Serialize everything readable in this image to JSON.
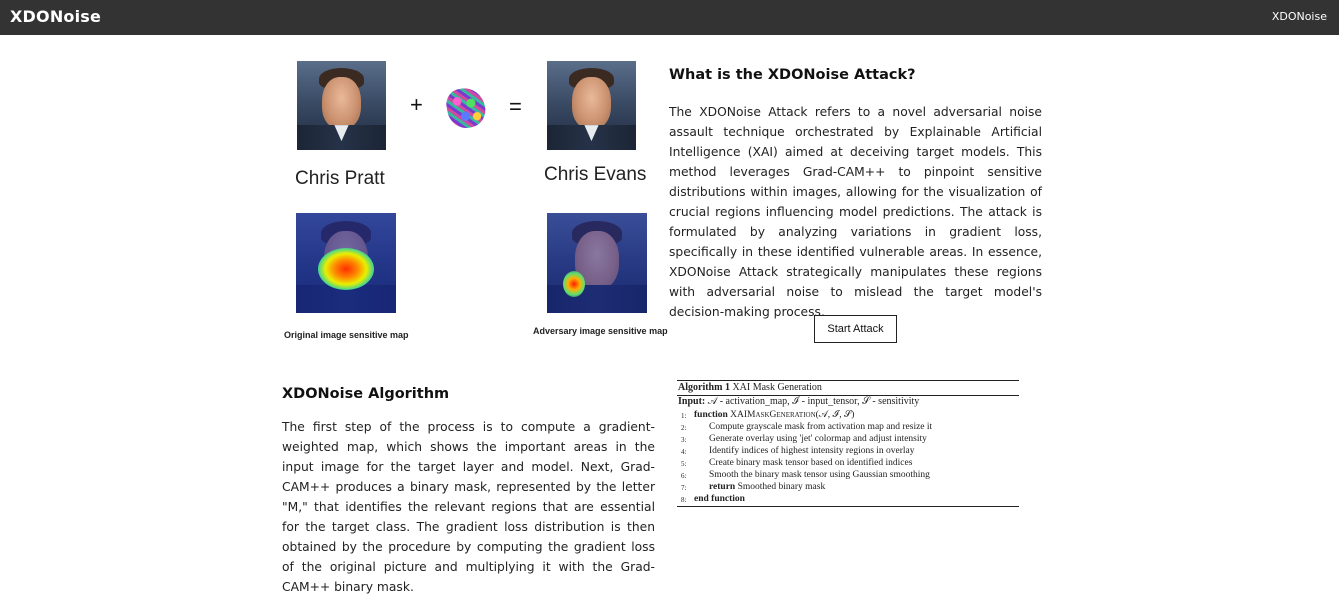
{
  "navbar": {
    "brand": "XDONoise",
    "link": "XDONoise"
  },
  "illustration": {
    "plus": "+",
    "equals": "=",
    "original_name": "Chris Pratt",
    "adversary_name": "Chris Evans",
    "original_caption": "Original image sensitive map",
    "adversary_caption": "Adversary image sensitive map"
  },
  "attack": {
    "title": "What is the XDONoise Attack?",
    "description": "The XDONoise Attack refers to a novel adversarial noise assault technique orchestrated by Explainable Artificial Intelligence (XAI) aimed at deceiving target models. This method leverages Grad-CAM++ to pinpoint sensitive distributions within images, allowing for the visualization of crucial regions influencing model predictions. The attack is formulated by analyzing variations in gradient loss, specifically in these identified vulnerable areas. In essence, XDONoise Attack strategically manipulates these regions with adversarial noise to mislead the target model's decision-making process.",
    "button_label": "Start Attack"
  },
  "algorithm_section": {
    "title": "XDONoise Algorithm",
    "description": "The first step of the process is to compute a gradient-weighted map, which shows the important areas in the input image for the target layer and model. Next, Grad-CAM++ produces a binary mask, represented by the letter \"M,\" that identifies the relevant regions that are essential for the target class. The gradient loss distribution is then obtained by the procedure by computing the gradient loss of the original picture and multiplying it with the Grad-CAM++ binary mask."
  },
  "algorithm_box": {
    "label": "Algorithm 1",
    "name": "XAI Mask Generation",
    "input_label": "Input:",
    "input_text": "𝒜 - activation_map, ℐ - input_tensor, 𝒮 - sensitivity",
    "lines": [
      {
        "n": "1:",
        "kw": "function",
        "text": "XAIMaskGeneration(𝒜, ℐ, 𝒮)"
      },
      {
        "n": "2:",
        "kw": "",
        "text": "Compute grayscale mask from activation map and resize it"
      },
      {
        "n": "3:",
        "kw": "",
        "text": "Generate overlay using 'jet' colormap and adjust intensity"
      },
      {
        "n": "4:",
        "kw": "",
        "text": "Identify indices of highest intensity regions in overlay"
      },
      {
        "n": "5:",
        "kw": "",
        "text": "Create binary mask tensor based on identified indices"
      },
      {
        "n": "6:",
        "kw": "",
        "text": "Smooth the binary mask tensor using Gaussian smoothing"
      },
      {
        "n": "7:",
        "kw": "return",
        "text": "Smoothed binary mask"
      },
      {
        "n": "8:",
        "kw": "end function",
        "text": ""
      }
    ]
  }
}
